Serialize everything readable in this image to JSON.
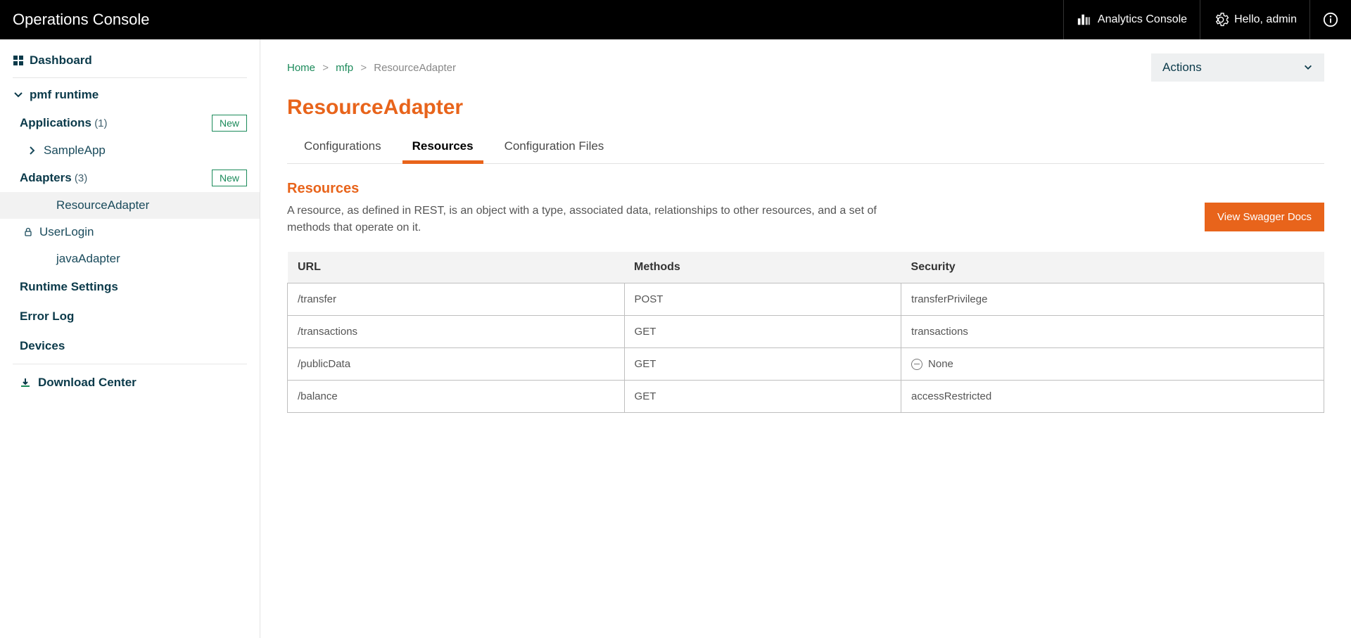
{
  "header": {
    "title": "Operations Console",
    "analytics": "Analytics Console",
    "greeting": "Hello, admin"
  },
  "sidebar": {
    "dashboard": "Dashboard",
    "runtime": "pmf runtime",
    "applications": {
      "label": "Applications",
      "count": "(1)",
      "new_label": "New"
    },
    "app_items": [
      "SampleApp"
    ],
    "adapters": {
      "label": "Adapters",
      "count": "(3)",
      "new_label": "New"
    },
    "adapter_items": [
      {
        "label": "ResourceAdapter",
        "active": true
      },
      {
        "label": "UserLogin",
        "active": false,
        "lock": true
      },
      {
        "label": "javaAdapter",
        "active": false
      }
    ],
    "links": [
      "Runtime Settings",
      "Error Log",
      "Devices"
    ],
    "download": "Download Center"
  },
  "breadcrumb": {
    "home": "Home",
    "mfp": "mfp",
    "current": "ResourceAdapter"
  },
  "actions_label": "Actions",
  "page_title": "ResourceAdapter",
  "tabs": [
    "Configurations",
    "Resources",
    "Configuration Files"
  ],
  "active_tab": 1,
  "section": {
    "title": "Resources",
    "description": "A resource, as defined in REST, is an object with a type, associated data, relationships to other resources, and a set of methods that operate on it.",
    "swagger_button": "View Swagger Docs"
  },
  "table": {
    "headers": [
      "URL",
      "Methods",
      "Security"
    ],
    "rows": [
      {
        "url": "/transfer",
        "methods": "POST",
        "security": "transferPrivilege"
      },
      {
        "url": "/transactions",
        "methods": "GET",
        "security": "transactions"
      },
      {
        "url": "/publicData",
        "methods": "GET",
        "security": "None",
        "none_icon": true
      },
      {
        "url": "/balance",
        "methods": "GET",
        "security": "accessRestricted"
      }
    ]
  }
}
